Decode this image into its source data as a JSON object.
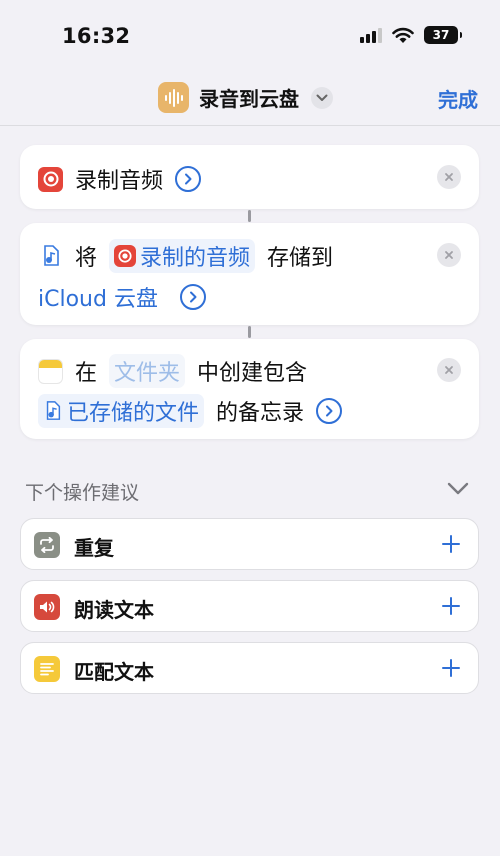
{
  "status_bar": {
    "time": "16:32",
    "battery": "37"
  },
  "nav": {
    "title": "录音到云盘",
    "done_label": "完成"
  },
  "actions": [
    {
      "label": "录制音频"
    },
    {
      "prefix": "将",
      "token": "录制的音频",
      "mid": "存储到",
      "destination": "iCloud 云盘"
    },
    {
      "prefix": "在",
      "folder_placeholder": "文件夹",
      "mid": "中创建包含",
      "token": "已存储的文件",
      "suffix": "的备忘录"
    }
  ],
  "suggestions": {
    "title": "下个操作建议",
    "items": [
      {
        "label": "重复",
        "icon": "repeat-icon",
        "color": "#8a8f86"
      },
      {
        "label": "朗读文本",
        "icon": "speaker-icon",
        "color": "#d6493c"
      },
      {
        "label": "匹配文本",
        "icon": "text-lines-icon",
        "color": "#f5c93a"
      }
    ]
  },
  "colors": {
    "accent": "#2f6fd6",
    "background": "#f2f1f6"
  }
}
